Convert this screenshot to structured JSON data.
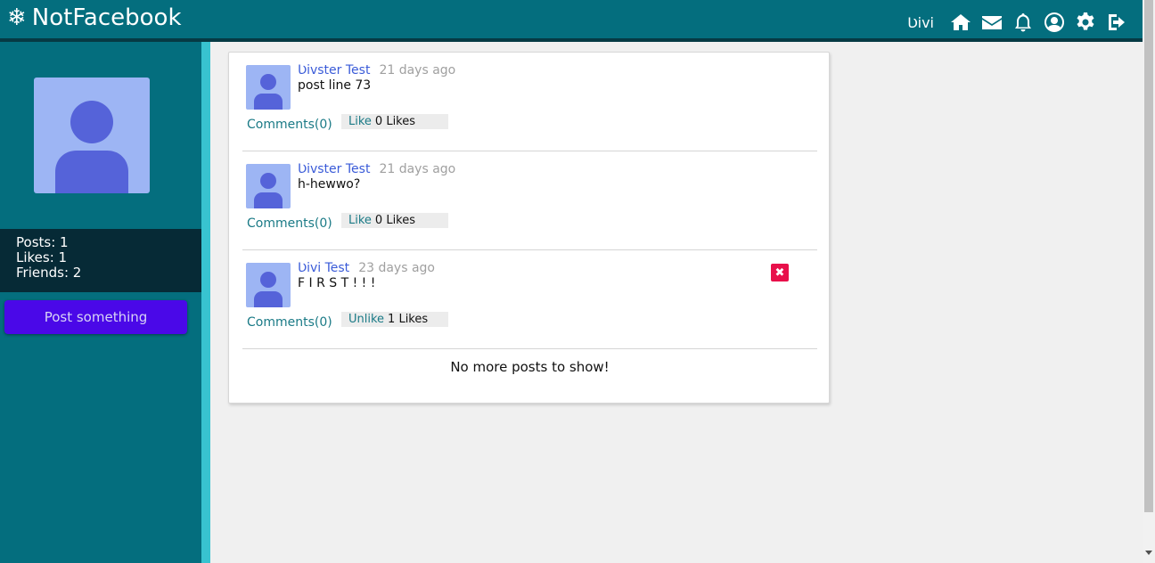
{
  "header": {
    "brand_icon": "❄",
    "brand": "NotFacebook",
    "username": "Ʋivi",
    "icons": [
      "home-icon",
      "mail-icon",
      "bell-icon",
      "user-circle-icon",
      "gear-icon",
      "logout-icon"
    ]
  },
  "sidebar": {
    "stats": [
      "Posts: 1",
      "Likes: 1",
      "Friends: 2"
    ],
    "post_button": "Post something"
  },
  "posts": [
    {
      "author": "Ʋivster Test",
      "time": "21 days ago",
      "text": "post line 73",
      "comments": "Comments(0)",
      "like_label": "Like",
      "likes": "0 Likes"
    },
    {
      "author": "Ʋivster Test",
      "time": "21 days ago",
      "text": "h-hewwo?",
      "comments": "Comments(0)",
      "like_label": "Like",
      "likes": "0 Likes"
    },
    {
      "author": "Ʋivi Test",
      "time": "23 days ago",
      "text": "F I R S T ! ! !",
      "comments": "Comments(0)",
      "like_label": "Unlike",
      "likes": "1 Likes"
    }
  ],
  "feed_end": "No more posts to show!",
  "colors": {
    "header": "#046e7e",
    "accent": "#38c3d0",
    "button": "#4a08e8",
    "delete": "#e8104a"
  }
}
